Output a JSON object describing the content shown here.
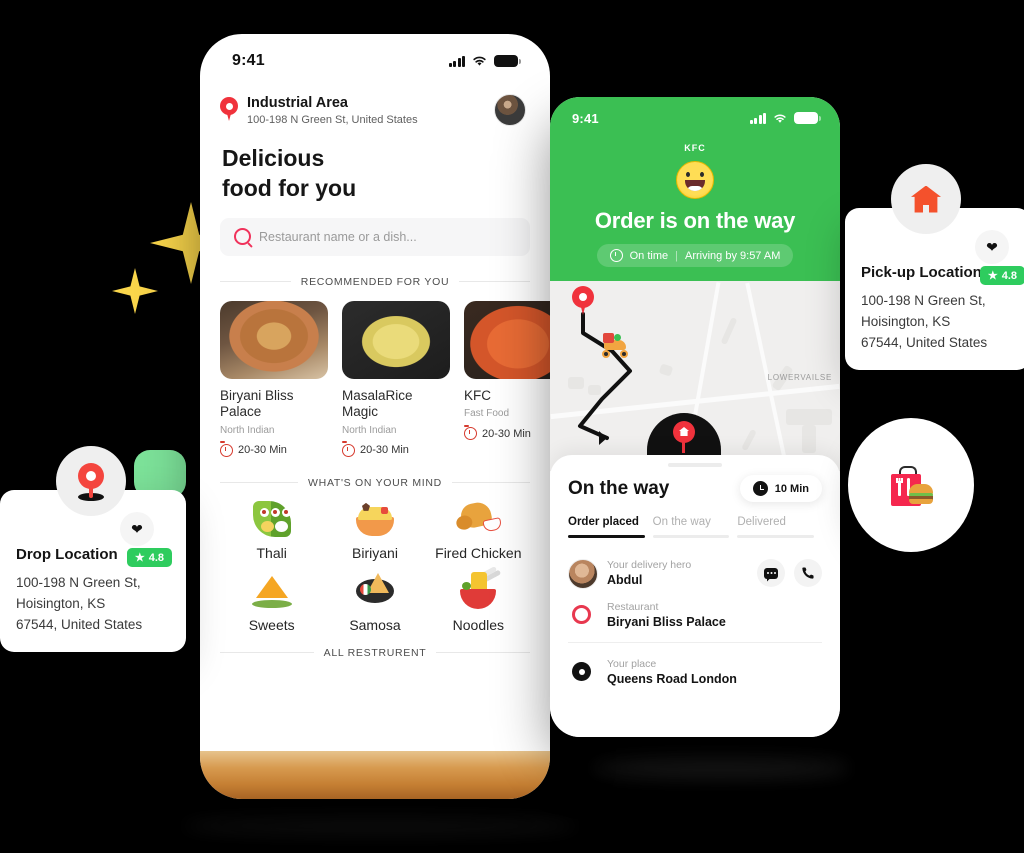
{
  "phone_home": {
    "status_bar": {
      "time": "9:41",
      "signal_icon": "cellular-signal-icon",
      "wifi_icon": "wifi-icon",
      "battery_icon": "battery-icon"
    },
    "location": {
      "pin_icon": "location-pin-icon",
      "title": "Industrial Area",
      "subtitle": "100-198 N Green St, United States",
      "avatar": "user-avatar"
    },
    "hero_line1": "Delicious",
    "hero_line2": "food for you",
    "search": {
      "icon": "search-icon",
      "placeholder": "Restaurant name or a dish..."
    },
    "recommended_heading": "RECOMMENDED FOR YOU",
    "restaurants": [
      {
        "name": "Biryani Bliss Palace",
        "category": "North Indian",
        "time": "20-30 Min",
        "image": "biryani-bowl-photo"
      },
      {
        "name": "MasalaRice Magic",
        "category": "North Indian",
        "time": "20-30 Min",
        "image": "masala-rice-photo"
      },
      {
        "name": "KFC",
        "category": "Fast Food",
        "time": "20-30 Min",
        "image": "curry-photo"
      }
    ],
    "mind_heading": "WHAT'S ON YOUR MIND",
    "cuisines": [
      {
        "label": "Thali",
        "icon": "thali-icon"
      },
      {
        "label": "Biriyani",
        "icon": "biriyani-bowl-icon"
      },
      {
        "label": "Fired Chicken",
        "icon": "fried-chicken-icon"
      },
      {
        "label": "Sweets",
        "icon": "sweets-icon"
      },
      {
        "label": "Samosa",
        "icon": "samosa-icon"
      },
      {
        "label": "Noodles",
        "icon": "noodles-bowl-icon"
      }
    ],
    "all_restaurants_heading": "ALL RESTRURENT"
  },
  "phone_tracking": {
    "status_bar": {
      "time": "9:41",
      "signal_icon": "cellular-signal-icon",
      "wifi_icon": "wifi-icon",
      "battery_icon": "battery-icon"
    },
    "brand": "KFC",
    "smiley_icon": "grinning-face-icon",
    "headline": "Order is on the way",
    "status_pill": {
      "clock_icon": "clock-icon",
      "status": "On time",
      "separator": "|",
      "eta_text": "Arriving by 9:57 AM"
    },
    "map": {
      "origin_pin": "origin-location-pin",
      "courier_icon": "delivery-scooter-icon",
      "destination_pin": "destination-home-pin",
      "area_label": "LOWERVAILSE"
    },
    "sheet": {
      "title": "On the way",
      "eta_badge": {
        "icon": "clock-icon",
        "text": "10 Min"
      },
      "tabs": [
        {
          "label": "Order placed",
          "active": true
        },
        {
          "label": "On the way",
          "active": false
        },
        {
          "label": "Delivered",
          "active": false
        }
      ],
      "rows": [
        {
          "key": "Your delivery hero",
          "value": "Abdul",
          "lead_icon": "courier-avatar"
        },
        {
          "key": "Restaurant",
          "value": "Biryani Bliss Palace",
          "lead_icon": "restaurant-marker-icon"
        },
        {
          "key": "Your place",
          "value": "Queens Road London",
          "lead_icon": "destination-marker-icon"
        }
      ],
      "chat_icon": "chat-bubble-icon",
      "call_icon": "phone-call-icon"
    }
  },
  "drop_card": {
    "icon": "map-pin-icon",
    "heart_icon": "heart-icon",
    "rating": "4.8",
    "star_icon": "star-icon",
    "title": "Drop Location",
    "address_line1": "100-198 N Green St,",
    "address_line2": "Hoisington, KS",
    "address_line3": "67544, United States"
  },
  "pickup_card": {
    "icon": "home-icon",
    "heart_icon": "heart-icon",
    "rating": "4.8",
    "star_icon": "star-icon",
    "title": "Pick-up Location",
    "address_line1": "100-198 N Green St,",
    "address_line2": "Hoisington, KS",
    "address_line3": "67544, United States"
  },
  "food_bag_badge": {
    "icon": "food-bag-burger-icon"
  },
  "colors": {
    "brand_green": "#3BBF53",
    "rating_green": "#2ECC5E",
    "accent_red": "#F0323C",
    "search_pink": "#F0325B",
    "sparkle_yellow": "#FAD64B",
    "home_orange": "#F4512C"
  }
}
